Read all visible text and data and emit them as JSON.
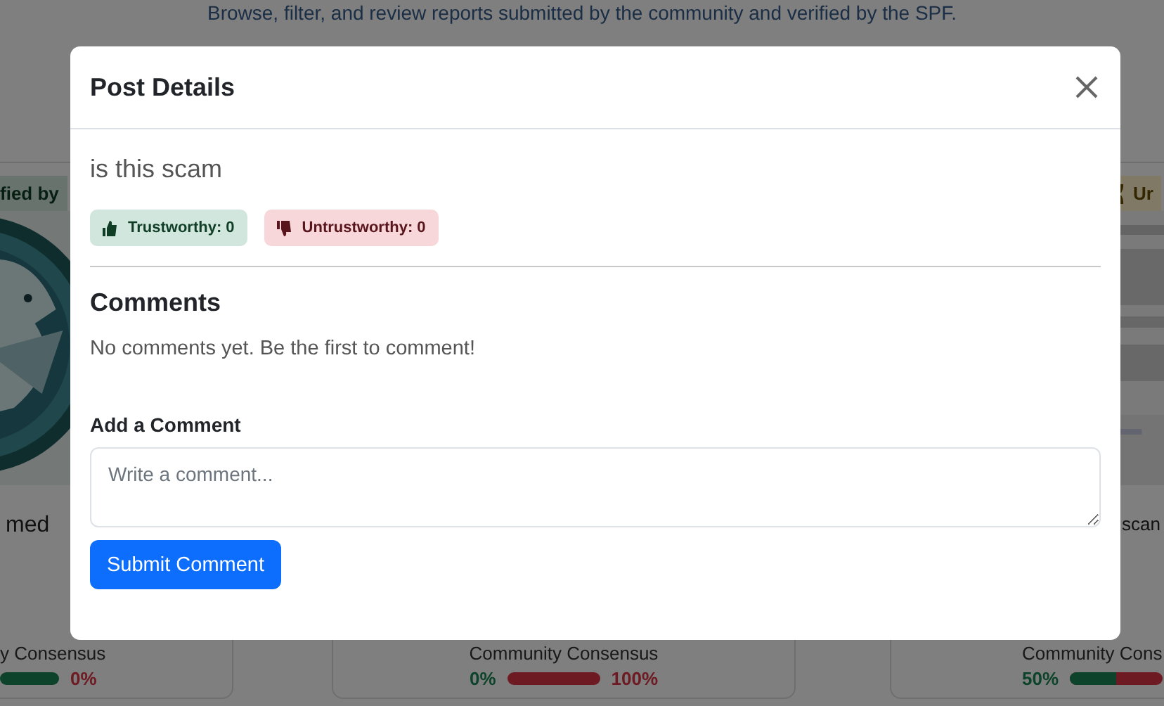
{
  "page": {
    "subtitle": "Browse, filter, and review reports submitted by the community and verified by the SPF."
  },
  "cards": [
    {
      "badge": {
        "text": "fied by",
        "kind": "verified"
      },
      "title": "med",
      "consensus_label": "y Consensus",
      "distrust": "0%",
      "level": 1
    },
    {
      "consensus_label": "Community Consensus",
      "trust": "0%",
      "distrust": "100%",
      "level": 0
    },
    {
      "badge": {
        "text": "Ur",
        "kind": "unverified"
      },
      "title": "scan",
      "consensus_label": "Community Cons",
      "trust": "50%",
      "level": 0.5
    }
  ],
  "modal": {
    "title": "Post Details",
    "post_title": "is this scam",
    "votes": [
      {
        "kind": "trust",
        "label": "Trustworthy: 0"
      },
      {
        "kind": "distrust",
        "label": "Untrustworthy: 0"
      }
    ],
    "comments_heading": "Comments",
    "empty_text": "No comments yet. Be the first to comment!",
    "add_label": "Add a Comment",
    "placeholder": "Write a comment...",
    "submit": "Submit Comment"
  }
}
